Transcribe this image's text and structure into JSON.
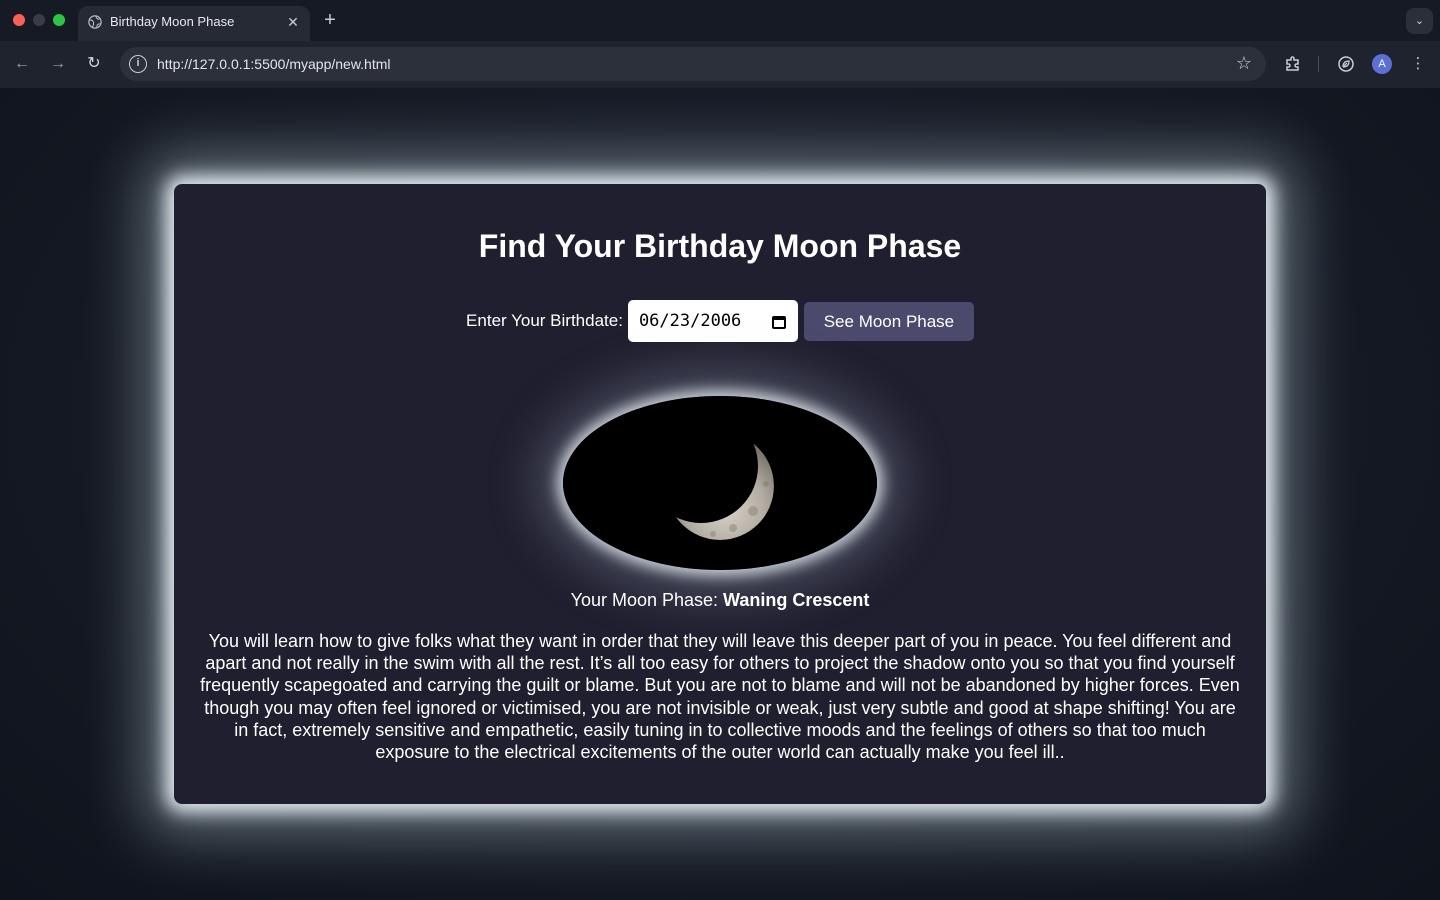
{
  "browser": {
    "tab_title": "Birthday Moon Phase",
    "url": "http://127.0.0.1:5500/myapp/new.html",
    "avatar_letter": "A"
  },
  "page": {
    "title": "Find Your Birthday Moon Phase",
    "form": {
      "label": "Enter Your Birthdate:",
      "date_value": "06/23/2006",
      "button_label": "See Moon Phase"
    },
    "result": {
      "phase_prefix": "Your Moon Phase:",
      "phase_name": "Waning Crescent",
      "description": "You will learn how to give folks what they want in order that they will leave this deeper part of you in peace. You feel different and apart and not really in the swim with all the rest. It’s all too easy for others to project the shadow onto you so that you find yourself frequently scapegoated and carrying the guilt or blame. But you are not to blame and will not be abandoned by higher forces. Even though you may often feel ignored or victimised, you are not invisible or weak, just very subtle and good at shape shifting! You are in fact, extremely sensitive and empathetic, easily tuning in to collective moods and the feelings of others so that too much exposure to the electrical excitements of the outer world can actually make you feel ill.."
    }
  },
  "icons": {
    "tab_favicon": "globe-icon",
    "tab_close": "close-icon",
    "new_tab": "plus-icon",
    "tab_search": "chevron-down-icon",
    "back": "arrow-left-icon",
    "forward": "arrow-right-icon",
    "reload": "reload-icon",
    "site_info": "info-icon",
    "bookmark": "star-icon",
    "extensions": "puzzle-icon",
    "performance": "leaf-icon",
    "menu": "kebab-menu-icon",
    "calendar": "calendar-icon"
  },
  "colors": {
    "card_background": "#201f30",
    "button_background": "#4b4a6c",
    "glow": "#ecf4f8"
  }
}
